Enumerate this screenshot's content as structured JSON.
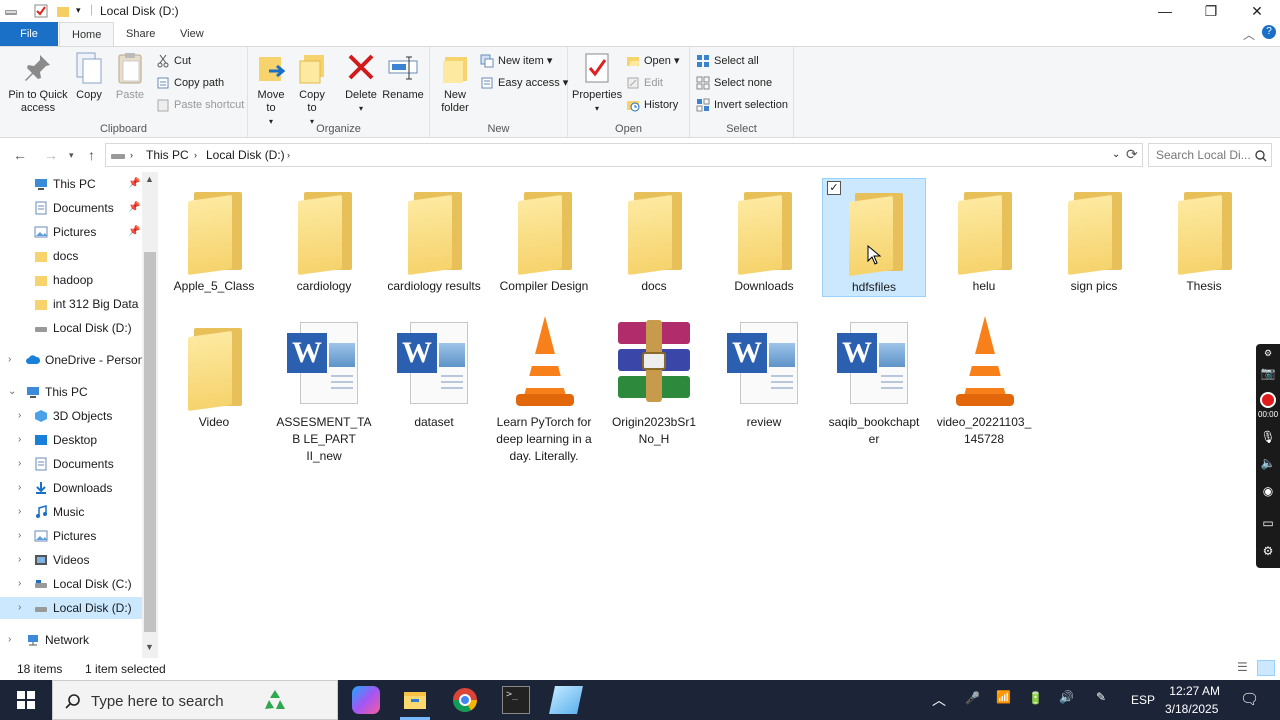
{
  "window": {
    "title": "Local Disk (D:)"
  },
  "ribbon_tabs": [
    "File",
    "Home",
    "Share",
    "View"
  ],
  "ribbon": {
    "clipboard": {
      "pin": "Pin to Quick access",
      "copy": "Copy",
      "paste": "Paste",
      "cut": "Cut",
      "copy_path": "Copy path",
      "paste_shortcut": "Paste shortcut",
      "label": "Clipboard"
    },
    "organize": {
      "move": "Move to",
      "copy": "Copy to",
      "delete": "Delete",
      "rename": "Rename",
      "label": "Organize"
    },
    "new": {
      "new_folder": "New folder",
      "new_item": "New item",
      "easy_access": "Easy access",
      "label": "New"
    },
    "open": {
      "properties": "Properties",
      "open": "Open",
      "edit": "Edit",
      "history": "History",
      "label": "Open"
    },
    "select": {
      "select_all": "Select all",
      "select_none": "Select none",
      "invert": "Invert selection",
      "label": "Select"
    }
  },
  "address": {
    "crumbs": [
      "This PC",
      "Local Disk (D:)"
    ],
    "search_placeholder": "Search Local Di..."
  },
  "nav": {
    "quick": [
      {
        "label": "This PC",
        "pinned": true
      },
      {
        "label": "Documents",
        "pinned": true
      },
      {
        "label": "Pictures",
        "pinned": true
      },
      {
        "label": "docs"
      },
      {
        "label": "hadoop"
      },
      {
        "label": "int 312 Big Data"
      },
      {
        "label": "Local Disk (D:)"
      }
    ],
    "onedrive": "OneDrive - Person",
    "thispc": "This PC",
    "thispc_items": [
      "3D Objects",
      "Desktop",
      "Documents",
      "Downloads",
      "Music",
      "Pictures",
      "Videos",
      "Local Disk (C:)",
      "Local Disk (D:)"
    ],
    "network": "Network"
  },
  "items": [
    {
      "name": "Apple_5_Class",
      "type": "folder"
    },
    {
      "name": "cardiology",
      "type": "folder"
    },
    {
      "name": "cardiology results",
      "type": "folder"
    },
    {
      "name": "Compiler Design",
      "type": "folder"
    },
    {
      "name": "docs",
      "type": "folder"
    },
    {
      "name": "Downloads",
      "type": "folder"
    },
    {
      "name": "hdfsfiles",
      "type": "folder",
      "selected": true
    },
    {
      "name": "helu",
      "type": "folder"
    },
    {
      "name": "sign pics",
      "type": "folder"
    },
    {
      "name": "Thesis",
      "type": "folder"
    },
    {
      "name": "Video",
      "type": "folder"
    },
    {
      "name": "ASSESMENT_TAB LE_PART II_new",
      "type": "word"
    },
    {
      "name": "dataset",
      "type": "word"
    },
    {
      "name": "Learn PyTorch for deep learning in a day. Literally.",
      "type": "vlc"
    },
    {
      "name": "Origin2023bSr1 No_H",
      "type": "rar"
    },
    {
      "name": "review",
      "type": "word"
    },
    {
      "name": "saqib_bookchapt er",
      "type": "word"
    },
    {
      "name": "video_20221103_ 145728",
      "type": "vlc"
    }
  ],
  "status": {
    "count": "18 items",
    "selected": "1 item selected"
  },
  "taskbar": {
    "search": "Type here to search",
    "lang": "ESP",
    "time": "12:27 AM",
    "date": "3/18/2025"
  },
  "recorder": {
    "timer": "00:00"
  },
  "colors": {
    "file_tab": "#1a6fc7",
    "selection": "#cce8ff",
    "taskbar": "#1c2538"
  }
}
